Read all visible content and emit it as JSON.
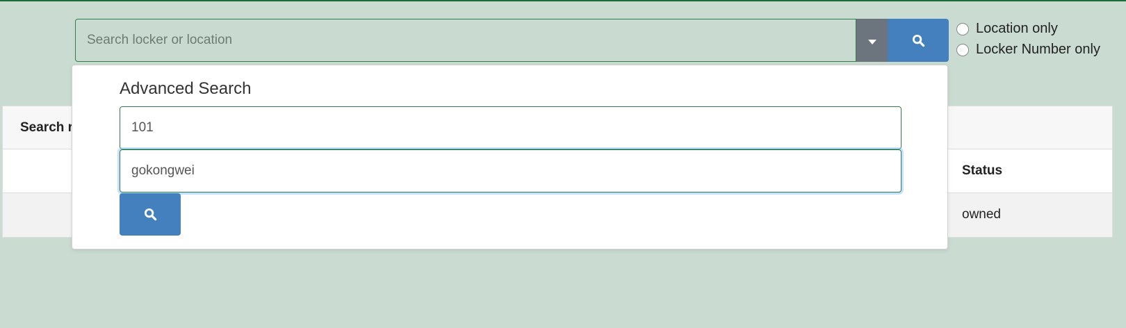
{
  "search": {
    "placeholder": "Search locker or location",
    "value": ""
  },
  "filters": [
    {
      "label": "Location only",
      "checked": false
    },
    {
      "label": "Locker Number only",
      "checked": false
    }
  ],
  "icons": {
    "dropdown": "caret-down-icon",
    "search": "search-icon"
  },
  "advanced_search": {
    "title": "Advanced Search",
    "locker_value": "101",
    "location_value": "gokongwei"
  },
  "results": {
    "heading": "Search r",
    "columns": [
      "Status"
    ],
    "rows": [
      {
        "status": "owned"
      }
    ]
  },
  "colors": {
    "background": "#cadbd1",
    "accent_green": "#1e6b3a",
    "button_blue": "#4380bd",
    "toggle_gray": "#6c757d"
  }
}
